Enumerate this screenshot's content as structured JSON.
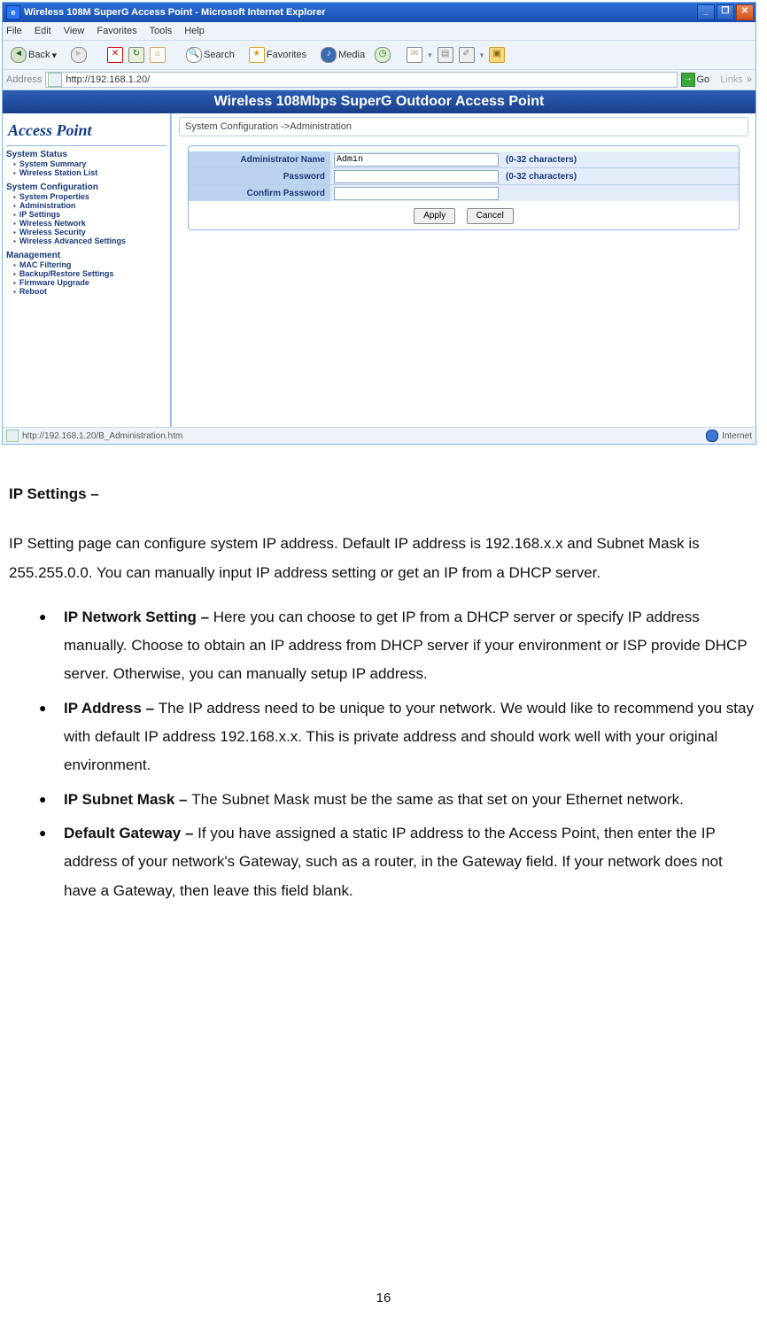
{
  "window": {
    "title": "Wireless 108M SuperG Access Point - Microsoft Internet Explorer",
    "btn_min": "_",
    "btn_max": "❐",
    "btn_close": "✕"
  },
  "menus": [
    "File",
    "Edit",
    "View",
    "Favorites",
    "Tools",
    "Help"
  ],
  "toolbar": {
    "back": "Back",
    "search": "Search",
    "favorites": "Favorites",
    "media": "Media"
  },
  "address": {
    "label": "Address",
    "value": "http://192.168.1.20/",
    "go": "Go",
    "links": "Links"
  },
  "app": {
    "banner": "Wireless 108Mbps SuperG Outdoor Access Point",
    "sidebar": {
      "title": "Access Point",
      "groups": [
        {
          "heading": "System Status",
          "items": [
            "System Summary",
            "Wireless Station List"
          ]
        },
        {
          "heading": "System Configuration",
          "items": [
            "System Properties",
            "Administration",
            "IP Settings",
            "Wireless Network",
            "Wireless Security",
            "Wireless Advanced Settings"
          ]
        },
        {
          "heading": "Management",
          "items": [
            "MAC Filtering",
            "Backup/Restore Settings",
            "Firmware Upgrade",
            "Reboot"
          ]
        }
      ]
    },
    "breadcrumb": "System Configuration ->Administration",
    "form": {
      "rows": [
        {
          "label": "Administrator Name",
          "value": "Admin",
          "hint": "(0-32 characters)"
        },
        {
          "label": "Password",
          "value": "",
          "hint": "(0-32 characters)"
        },
        {
          "label": "Confirm Password",
          "value": "",
          "hint": ""
        }
      ],
      "apply": "Apply",
      "cancel": "Cancel"
    }
  },
  "statusbar": {
    "left": "http://192.168.1.20/B_Administration.htm",
    "right": "Internet"
  },
  "doc": {
    "heading": "IP Settings –",
    "intro": "IP Setting page can configure system IP address. Default IP address is 192.168.x.x and Subnet Mask is 255.255.0.0. You can manually input IP address setting or get an IP from a DHCP server.",
    "bullets": [
      {
        "lead": "IP Network Setting – ",
        "body": "Here you can choose to get IP from a DHCP server or specify IP address manually. Choose to obtain an IP address from DHCP server if your environment or ISP provide DHCP server. Otherwise, you can manually setup IP address."
      },
      {
        "lead": "IP Address – ",
        "body": "The IP address need to be unique to your network. We would like to recommend you stay with default IP address 192.168.x.x. This is private address and should work well with your original environment."
      },
      {
        "lead": "IP Subnet Mask – ",
        "body": "The Subnet Mask must be the same as that set on your Ethernet network."
      },
      {
        "lead": "Default Gateway – ",
        "body": "If you have assigned a static IP address to the Access Point, then enter the IP address of your network's Gateway, such as a router, in the Gateway field. If your network does not have a Gateway, then leave this field blank."
      }
    ],
    "page_number": "16"
  }
}
